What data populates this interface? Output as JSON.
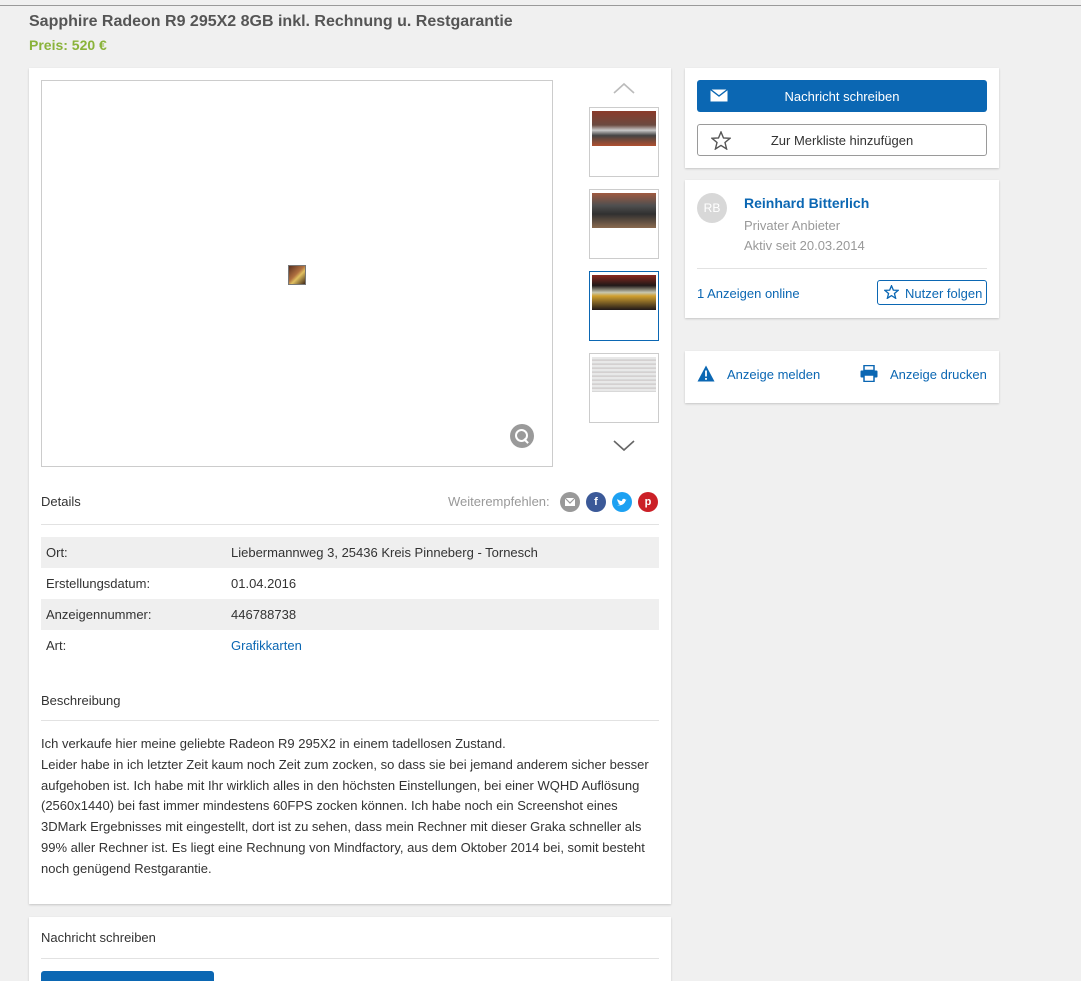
{
  "listing": {
    "title": "Sapphire Radeon R9 295X2 8GB inkl. Rechnung u. Restgarantie",
    "price": "Preis: 520 €"
  },
  "gallery": {
    "zoom_icon": "magnifier-icon",
    "thumbnails": [
      {
        "alt": "thumbnail-1"
      },
      {
        "alt": "thumbnail-2"
      },
      {
        "alt": "thumbnail-3",
        "active": true
      },
      {
        "alt": "thumbnail-4"
      }
    ]
  },
  "details": {
    "heading": "Details",
    "share_label": "Weiterempfehlen:",
    "share_icons": [
      "email-icon",
      "facebook-icon",
      "twitter-icon",
      "pinterest-icon"
    ],
    "rows": [
      {
        "key": "Ort:",
        "value": "Liebermannweg 3, 25436 Kreis Pinneberg - Tornesch"
      },
      {
        "key": "Erstellungsdatum:",
        "value": "01.04.2016"
      },
      {
        "key": "Anzeigennummer:",
        "value": "446788738"
      },
      {
        "key": "Art:",
        "value": "Grafikkarten"
      }
    ]
  },
  "description": {
    "heading": "Beschreibung",
    "lines": [
      "Ich verkaufe hier meine geliebte Radeon R9 295X2 in einem tadellosen Zustand.",
      "Leider habe in ich letzter Zeit kaum noch Zeit zum zocken, so dass sie bei jemand anderem sicher besser aufgehoben ist. Ich habe mit Ihr wirklich alles in den höchsten Einstellungen, bei einer WQHD Auflösung (2560x1440) bei fast immer mindestens 60FPS zocken können. Ich habe noch ein Screenshot eines 3DMark Ergebnisses mit eingestellt, dort ist zu sehen, dass mein Rechner mit dieser Graka schneller als 99% aller Rechner ist. Es liegt eine Rechnung von Mindfactory, aus dem Oktober 2014 bei, somit besteht noch genügend Restgarantie."
    ]
  },
  "contact": {
    "heading": "Nachricht schreiben"
  },
  "actions": {
    "message_button": "Nachricht schreiben",
    "watchlist_button": "Zur Merkliste hinzufügen"
  },
  "seller": {
    "initials": "RB",
    "name": "Reinhard Bitterlich",
    "type": "Privater Anbieter",
    "active_since": "Aktiv seit 20.03.2014",
    "ads_online": "1 Anzeigen online",
    "follow_button": "Nutzer folgen"
  },
  "report": {
    "report_label": "Anzeige melden",
    "print_label": "Anzeige drucken"
  },
  "colors": {
    "accent": "#0b67b3",
    "price": "#8ab33a"
  }
}
